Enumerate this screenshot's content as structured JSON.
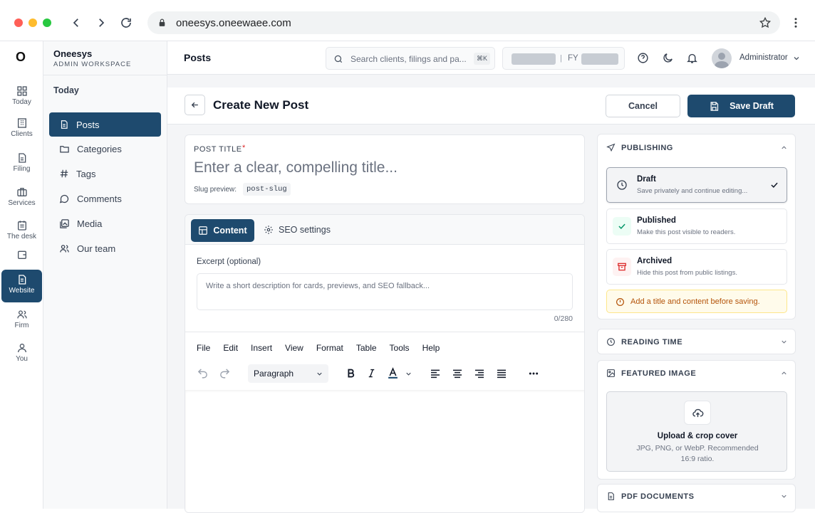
{
  "browser": {
    "url": "oneesys.oneewaee.com"
  },
  "rail": {
    "logo": "O",
    "items": [
      {
        "label": "Today"
      },
      {
        "label": "Clients"
      },
      {
        "label": "Filing"
      },
      {
        "label": "Services"
      },
      {
        "label": "The desk"
      },
      {
        "label": ""
      },
      {
        "label": "Website"
      },
      {
        "label": "Firm"
      },
      {
        "label": "You"
      }
    ]
  },
  "sidebar": {
    "brand": "Oneesys",
    "subtitle": "ADMIN WORKSPACE",
    "section": "Today",
    "items": [
      {
        "label": "Posts"
      },
      {
        "label": "Categories"
      },
      {
        "label": "Tags"
      },
      {
        "label": "Comments"
      },
      {
        "label": "Media"
      },
      {
        "label": "Our team"
      }
    ]
  },
  "topbar": {
    "title": "Posts",
    "search_placeholder": "Search clients, filings and pa...",
    "shortcut": "⌘K",
    "fy_label": "FY",
    "user": "Administrator"
  },
  "header": {
    "title": "Create New Post",
    "cancel": "Cancel",
    "save": "Save Draft"
  },
  "post": {
    "title_label": "POST TITLE",
    "required": "*",
    "title_placeholder": "Enter a clear, compelling title...",
    "slug_label": "Slug preview:",
    "slug_value": "post-slug"
  },
  "tabs": {
    "content": "Content",
    "seo": "SEO settings"
  },
  "excerpt": {
    "label": "Excerpt (optional)",
    "placeholder": "Write a short description for cards, previews, and SEO fallback...",
    "count": "0/280"
  },
  "editor": {
    "menu": [
      "File",
      "Edit",
      "Insert",
      "View",
      "Format",
      "Table",
      "Tools",
      "Help"
    ],
    "block": "Paragraph"
  },
  "publishing": {
    "heading": "PUBLISHING",
    "options": [
      {
        "title": "Draft",
        "desc": "Save privately and continue editing..."
      },
      {
        "title": "Published",
        "desc": "Make this post visible to readers."
      },
      {
        "title": "Archived",
        "desc": "Hide this post from public listings."
      }
    ],
    "warning": "Add a title and content before saving."
  },
  "reading_time": {
    "heading": "READING TIME"
  },
  "featured": {
    "heading": "FEATURED IMAGE",
    "upload_title": "Upload & crop cover",
    "upload_desc1": "JPG, PNG, or WebP. Recommended",
    "upload_desc2": "16:9 ratio."
  },
  "pdf": {
    "heading": "PDF DOCUMENTS"
  },
  "colors": {
    "primary": "#1e4a6e",
    "warning_bg": "#fffbeb",
    "warning_text": "#b45309",
    "required": "#dc2626"
  }
}
